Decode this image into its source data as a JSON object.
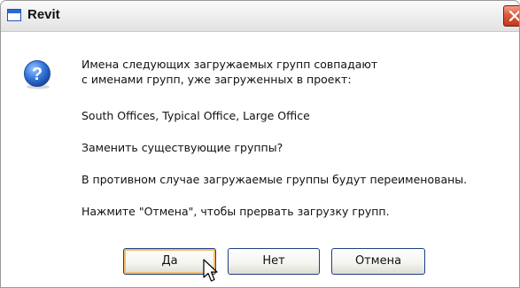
{
  "window": {
    "title": "Revit",
    "title_icon": "revit-window-icon",
    "close_icon": "close-x-icon"
  },
  "message": {
    "icon": "question-icon",
    "line1": "Имена следующих загружаемых групп совпадают",
    "line2": "с именами групп, уже загруженных в проект:",
    "groups": "South Offices, Typical Office, Large Office",
    "question": "Заменить существующие группы?",
    "otherwise": "В противном случае загружаемые группы будут переименованы.",
    "cancel_hint": "Нажмите \"Отмена\", чтобы прервать загрузку групп."
  },
  "buttons": {
    "yes": "Да",
    "no": "Нет",
    "cancel": "Отмена"
  },
  "cursor": {
    "icon": "mouse-pointer-icon"
  },
  "colors": {
    "close_button": "#dc5a3c",
    "default_button_focus": "#f5bd6b",
    "button_border": "#1e3f84",
    "question_icon": "#1f5fc4"
  }
}
